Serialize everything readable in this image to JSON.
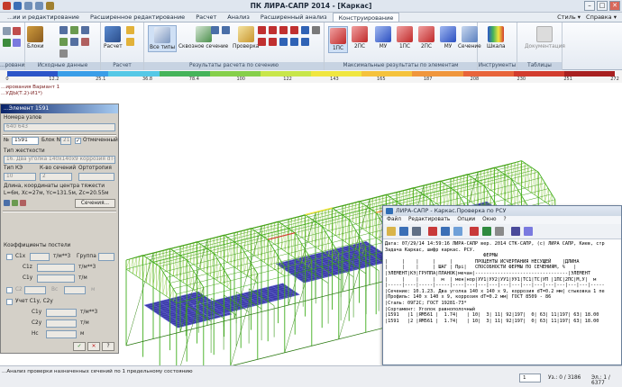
{
  "window": {
    "title": "ПК ЛИРА-САПР 2014 - [Каркас]",
    "controls": [
      "–",
      "□",
      "✕"
    ]
  },
  "ribbon_tabs": [
    "...ии и редактирование",
    "Расширенное редактирование",
    "Расчет",
    "Анализ",
    "Расширенный анализ",
    "Конструирование"
  ],
  "ribbon_right": {
    "style": "Стиль ▾",
    "help": "Справка ▾"
  },
  "ribbon": {
    "buttons": {
      "blocks": "Блоки",
      "calc": "Расчет",
      "all_types": "Все типы",
      "through_section": "Сквозное сечение",
      "check": "Проверка",
      "r1": "1ПС",
      "r2": "2ПС",
      "r3": "МУ",
      "r4": "1ПС",
      "r5": "2ПС",
      "r6": "МУ",
      "section": "Сечение",
      "scale": "Шкала",
      "doc": "Документация"
    },
    "groups": {
      "g1": "...рования",
      "g2": "Исходные данные",
      "g3": "Расчет",
      "g4": "Результаты расчета по сечению",
      "g5": "Максимальные результаты по элементам",
      "g6": "Инструменты",
      "g7": "Таблицы"
    }
  },
  "color_scale": {
    "colors": [
      "#2c55c8",
      "#3a9ee8",
      "#55c8e6",
      "#46b45a",
      "#86cf4a",
      "#c8e64a",
      "#f0e640",
      "#f5c23c",
      "#f0963c",
      "#e8643a",
      "#d23c2e",
      "#a82020"
    ],
    "labels": [
      "0",
      "12.2",
      "25.1",
      "36.8",
      "78.4",
      "100",
      "122",
      "143",
      "165",
      "187",
      "208",
      "230",
      "251",
      "272"
    ]
  },
  "info_lines": [
    "...ирования Вариант 1",
    "...УДЫ(Т.2)-И1*)"
  ],
  "element_panel": {
    "title": "...Элемент 1591",
    "nodes_label": "Номера узлов",
    "nodes_value": "640 643",
    "num_label": "№",
    "num_value": "1591",
    "block_label": "Блок N",
    "block_value": "21",
    "marked_label": "Отмеченный",
    "stiffness_label": "Тип жесткости",
    "stiffness_value": "16. Два уголка 140х140х9 коррозия dT=0.2",
    "fe_type_label": "Тип КЭ",
    "fe_type_value": "10",
    "sections_label": "К-во сечений",
    "sections_value": "2",
    "ortho_label": "Ортотропия",
    "length_label": "Длина, координаты центра тяжести",
    "length_value": "L=6м, Xc=27м, Yc=131.5м, Zc=20.55м",
    "sections_button": "Сечения...",
    "bed_label": "Коэффициенты постели",
    "c1x": "C1x",
    "c1z": "C1z",
    "c1y": "C1y",
    "c2": "C2",
    "group": "Группа",
    "unit_tm3": "т/м**3",
    "unit_tm2": "т/м**2",
    "unit_tm": "т/м",
    "bc": "Bc",
    "account_label": "Учет C1y, C2y",
    "c1y2": "C1y",
    "c2y": "C2y",
    "hc": "Hc",
    "unit_m": "м",
    "apply_check": "✓",
    "cancel_x": "✕",
    "help_q": "?",
    "more": ">>"
  },
  "report": {
    "title": "ЛИРА-САПР - Каркас.Проверка по РСУ",
    "menu": [
      "Файл",
      "Редактировать",
      "Опции",
      "Окно",
      "?"
    ],
    "lines": [
      "Дата: 07/29/14 14:59:16 ЛИРА-САПР вер. 2014 СТК-САПР, (c) ЛИРА САПР, Киев, стр",
      "Задача Каркас, шифр каркас. РСУ.",
      "                                   ФЕРМЫ",
      "|     |    |     |     |        ПРОЦЕНТЫ ИСЧЕРПАНИЯ НЕСУЩЕЙ    |ДЛИНА",
      "|     |    |     | ШАГ | Прi|   СПОСОБНОСТИ ФЕРМЫ ПО СЕЧЕНИЯМ, %   |",
      "|ЭЛЕМЕНТ|КЭ|ГРУППА|ПЛАНОК|мечан|---------------------------------|ЭЛЕМЕНТ",
      "|     |    |     |  м  | мен|нор|УУ1|УУ2|УУ1|УУ1|ТС1|ТС|УП |1ПС|2ПС|М,У|  м",
      "|-----|----|-----|-----|----|---|---|---|---|---|---|---|---|---|---|---|-----",
      "|Сечение: 10.1.23. Два уголка 140 x 140 x 9, коррозия dT=0.2 мм| стыковка 1 пе",
      "|Профиль: 140 x 140 x 9, коррозия dT=0.2 мм| ГОСТ 8509 - 86",
      "|Сталь: 09Г2С; ГОСТ 19281-73*",
      "|Сортамент: Уголок равнополочный",
      "|1591   |1 |ЯМ561 |  1.74|   | 10|  3| 11| 92|197|  0| 63| 11|197| 63| 18.00",
      "|1591   |2 |ЯМ561 |  1.74|   | 10|  3| 11| 92|197|  0| 63| 11|197| 63| 18.00"
    ]
  },
  "status": {
    "message": "...Анализ проверки назначенных сечений по 1 предельному состоянию",
    "node_count": "1",
    "node_text": "Уз.: 0 / 3186",
    "elem_text": "Эл.: 1 / 6377"
  },
  "accent": {
    "title_blue": "#0a246a",
    "struct_green": "#3fae1c",
    "plate_blue": "#28288c"
  }
}
